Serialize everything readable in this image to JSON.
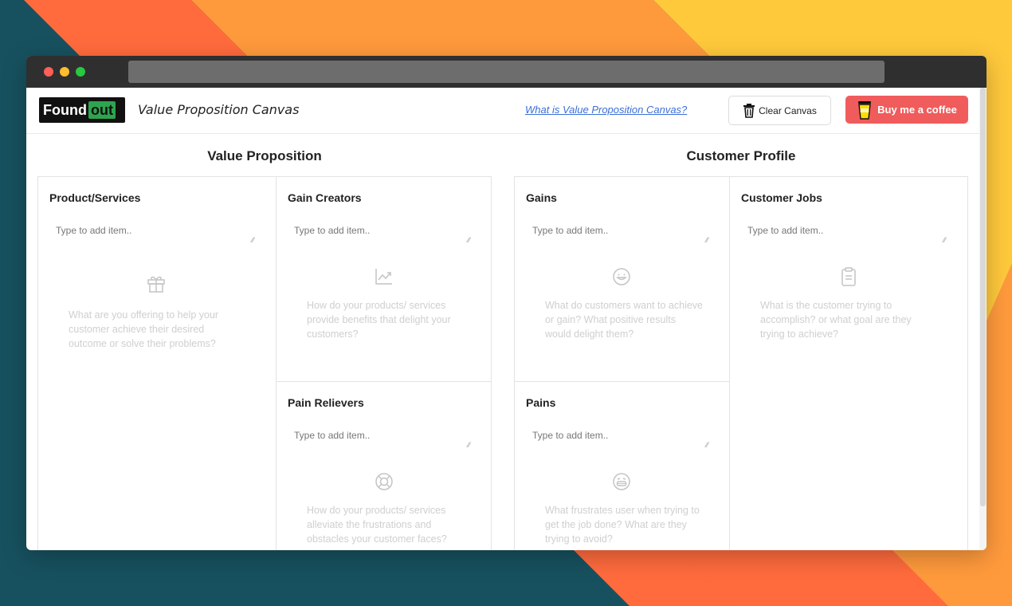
{
  "app": {
    "logo_found": "Found",
    "logo_out": "out",
    "title": "Value Proposition Canvas",
    "help_link": "What is Value Proposition Canvas?",
    "clear_label": "Clear Canvas",
    "coffee_label": "Buy me a coffee"
  },
  "sections": {
    "value_proposition": "Value Proposition",
    "customer_profile": "Customer Profile"
  },
  "cells": {
    "product_services": {
      "title": "Product/Services",
      "placeholder": "Type to add item..",
      "icon": "gift-icon",
      "hint": "What are you offering to help your customer achieve their desired outcome or solve their problems?"
    },
    "gain_creators": {
      "title": "Gain Creators",
      "placeholder": "Type to add item..",
      "icon": "chart-up-icon",
      "hint": "How do your products/ services provide benefits that delight your customers?"
    },
    "pain_relievers": {
      "title": "Pain Relievers",
      "placeholder": "Type to add item..",
      "icon": "lifebuoy-icon",
      "hint": "How do your products/ services alleviate the frustrations and obstacles your customer faces?"
    },
    "gains": {
      "title": "Gains",
      "placeholder": "Type to add item..",
      "icon": "smile-icon",
      "hint": "What do customers want to achieve or gain? What positive results would delight them?"
    },
    "pains": {
      "title": "Pains",
      "placeholder": "Type to add item..",
      "icon": "frustrated-face-icon",
      "hint": "What frustrates user when trying to get the job done? What are they trying to avoid?"
    },
    "customer_jobs": {
      "title": "Customer Jobs",
      "placeholder": "Type to add item..",
      "icon": "clipboard-icon",
      "hint": "What is the customer trying to accomplish? or what goal are they trying to achieve?"
    }
  },
  "colors": {
    "background_teal": "#17515f",
    "stripe_red": "#ff6b3d",
    "stripe_orange": "#ff9a3c",
    "stripe_yellow": "#ffc93c",
    "coffee_button": "#f05c5c",
    "link": "#3b6fd6"
  }
}
